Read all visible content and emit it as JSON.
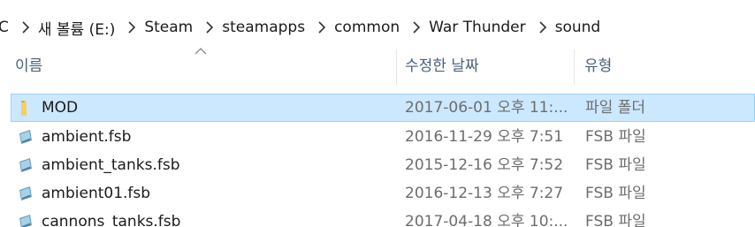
{
  "breadcrumb": {
    "items": [
      "C",
      "새 볼륨 (E:)",
      "Steam",
      "steamapps",
      "common",
      "War Thunder",
      "sound"
    ],
    "separator_icon": "chevron-right-icon"
  },
  "columns": {
    "name": "이름",
    "date_modified": "수정한 날짜",
    "type": "유형",
    "sort_indicator_icon": "sort-ascending-icon"
  },
  "files": [
    {
      "name": "MOD",
      "date": "2017-06-01 오후 11:...",
      "type": "파일 폴더",
      "icon": "folder-icon",
      "selected": true
    },
    {
      "name": "ambient.fsb",
      "date": "2016-11-29 오후 7:51",
      "type": "FSB 파일",
      "icon": "file-icon",
      "selected": false
    },
    {
      "name": "ambient_tanks.fsb",
      "date": "2015-12-16 오후 7:52",
      "type": "FSB 파일",
      "icon": "file-icon",
      "selected": false
    },
    {
      "name": "ambient01.fsb",
      "date": "2016-12-13 오후 7:27",
      "type": "FSB 파일",
      "icon": "file-icon",
      "selected": false
    },
    {
      "name": "cannons_tanks.fsb",
      "date": "2017-04-18 오후 10:...",
      "type": "FSB 파일",
      "icon": "file-icon",
      "selected": false
    }
  ],
  "colors": {
    "selection_bg": "#cce8ff",
    "selection_border": "#99d1ff",
    "header_text": "#4c607a",
    "secondary_text": "#6d6d6d"
  }
}
